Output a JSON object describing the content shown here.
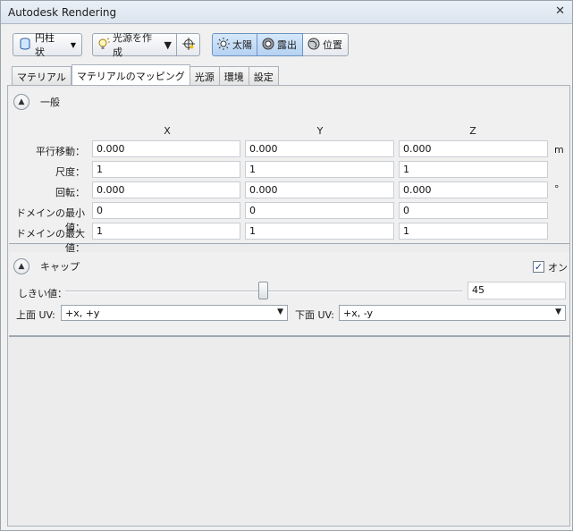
{
  "window": {
    "title": "Autodesk Rendering",
    "close_glyph": "✕"
  },
  "toolbar": {
    "cylinder_button": {
      "label": "円柱状",
      "icon": "cylinder-map-icon"
    },
    "create_light_button": {
      "label": "光源を作成",
      "icon": "light-bulb-icon"
    },
    "light_target_icon": "crosshair-icon",
    "sun_button": {
      "label": "太陽",
      "icon": "sun-icon"
    },
    "exposure_button": {
      "label": "露出",
      "icon": "exposure-icon"
    },
    "location_button": {
      "label": "位置",
      "icon": "globe-icon"
    }
  },
  "tabs": [
    {
      "label": "マテリアル",
      "active": false
    },
    {
      "label": "マテリアルのマッピング",
      "active": true
    },
    {
      "label": "光源",
      "active": false
    },
    {
      "label": "環境",
      "active": false
    },
    {
      "label": "設定",
      "active": false
    }
  ],
  "general": {
    "title": "一般",
    "columns": [
      "X",
      "Y",
      "Z"
    ],
    "rows": [
      {
        "label": "平行移動：",
        "values": [
          "0.000",
          "0.000",
          "0.000"
        ],
        "unit": "m"
      },
      {
        "label": "尺度：",
        "values": [
          "1",
          "1",
          "1"
        ],
        "unit": ""
      },
      {
        "label": "回転：",
        "values": [
          "0.000",
          "0.000",
          "0.000"
        ],
        "unit": "°"
      },
      {
        "label": "ドメインの最小値：",
        "values": [
          "0",
          "0",
          "0"
        ],
        "unit": ""
      },
      {
        "label": "ドメインの最大値：",
        "values": [
          "1",
          "1",
          "1"
        ],
        "unit": ""
      }
    ]
  },
  "cap": {
    "title": "キャップ",
    "on_label": "オン",
    "on_checked": true,
    "threshold_label": "しきい値：",
    "threshold_value": "45",
    "threshold_fraction": 0.5,
    "top_uv_label": "上面 UV:",
    "top_uv_value": "+x, +y",
    "bottom_uv_label": "下面 UV:",
    "bottom_uv_value": "+x, -y"
  },
  "colors": {
    "accent": "#b5d2f2",
    "titlebar": "#dbe4ef",
    "background": "#f0f0f0"
  }
}
